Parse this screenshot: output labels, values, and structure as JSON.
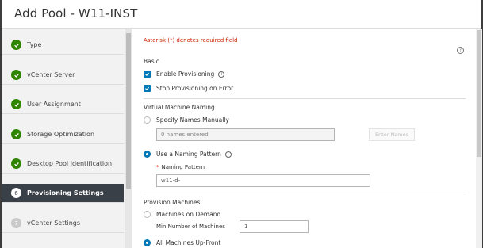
{
  "dialog": {
    "title": "Add Pool - W11-INST"
  },
  "steps": [
    {
      "label": "Type",
      "state": "done"
    },
    {
      "label": "vCenter Server",
      "state": "done"
    },
    {
      "label": "User Assignment",
      "state": "done"
    },
    {
      "label": "Storage Optimization",
      "state": "done"
    },
    {
      "label": "Desktop Pool Identification",
      "state": "done"
    },
    {
      "label": "Provisioning Settings",
      "state": "active",
      "number": "6"
    },
    {
      "label": "vCenter Settings",
      "state": "pending",
      "number": "7"
    }
  ],
  "form": {
    "required_note": "Asterisk (*) denotes required field",
    "help_icon": "?",
    "basic": {
      "heading": "Basic",
      "enable_provisioning": "Enable Provisioning",
      "stop_on_error": "Stop Provisioning on Error"
    },
    "naming": {
      "heading": "Virtual Machine Naming",
      "manual_label": "Specify Names Manually",
      "names_entered": "0 names entered",
      "enter_names_button": "Enter Names",
      "pattern_label": "Use a Naming Pattern",
      "pattern_field_label": "Naming Pattern",
      "pattern_value": "w11-d-"
    },
    "provision": {
      "heading": "Provision Machines",
      "on_demand_label": "Machines on Demand",
      "min_machines_label": "Min Number of Machines",
      "min_machines_value": "1",
      "up_front_label": "All Machines Up-Front"
    }
  },
  "colors": {
    "accent": "#0079b8",
    "done": "#2f8400",
    "active_bg": "#3a4048",
    "required": "#c92100"
  },
  "icons": {
    "done": "checkmark-icon",
    "info": "info-icon",
    "help": "help-icon"
  }
}
